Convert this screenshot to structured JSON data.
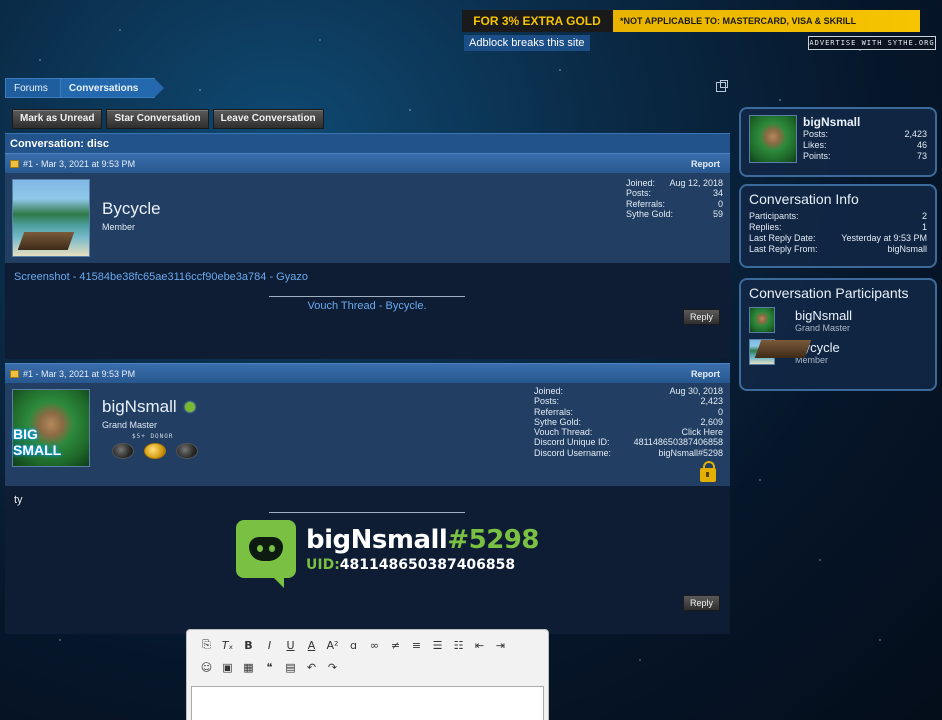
{
  "banner": {
    "left_text": "FOR 3% EXTRA GOLD",
    "right_text": "*NOT APPLICABLE TO: MASTERCARD, VISA & SKRILL",
    "adblock": "Adblock breaks this site",
    "advertise": "ADVERTISE WITH SYTHE.ORG"
  },
  "breadcrumb": {
    "forums": "Forums",
    "conversations": "Conversations"
  },
  "actions": {
    "mark_unread": "Mark as Unread",
    "star": "Star Conversation",
    "leave": "Leave Conversation"
  },
  "conversation": {
    "title": "Conversation: disc"
  },
  "posts": [
    {
      "meta": "#1 - Mar 3, 2021 at 9:53 PM",
      "report": "Report",
      "username": "Bycycle",
      "title": "Member",
      "stats": [
        {
          "label": "Joined:",
          "value": "Aug 12, 2018"
        },
        {
          "label": "Posts:",
          "value": "34"
        },
        {
          "label": "Referrals:",
          "value": "0"
        },
        {
          "label": "Sythe Gold:",
          "value": "59"
        }
      ],
      "link": "Screenshot - 41584be38fc65ae3116ccf90ebe3a784 - Gyazo",
      "signature": "Vouch Thread - Bycycle.",
      "reply": "Reply"
    },
    {
      "meta": "#1 - Mar 3, 2021 at 9:53 PM",
      "report": "Report",
      "username": "bigNsmall",
      "title": "Grand Master",
      "donor": "$5+ DONOR",
      "avatar_text": "BIG SMALL",
      "stats": [
        {
          "label": "Joined:",
          "value": "Aug 30, 2018"
        },
        {
          "label": "Posts:",
          "value": "2,423"
        },
        {
          "label": "Referrals:",
          "value": "0"
        },
        {
          "label": "Sythe Gold:",
          "value": "2,609"
        },
        {
          "label": "Vouch Thread:",
          "value": "Click Here"
        },
        {
          "label": "Discord Unique ID:",
          "value": "481148650387406858"
        },
        {
          "label": "Discord Username:",
          "value": "bigNsmall#5298"
        }
      ],
      "body": "ty",
      "discord_name": "bigNsmall",
      "discord_tag": "#5298",
      "discord_uid_label": "UID:",
      "discord_uid": "481148650387406858",
      "reply": "Reply"
    }
  ],
  "sidebar": {
    "profile": {
      "name": "bigNsmall",
      "stats": [
        {
          "label": "Posts:",
          "value": "2,423"
        },
        {
          "label": "Likes:",
          "value": "46"
        },
        {
          "label": "Points:",
          "value": "73"
        }
      ]
    },
    "info": {
      "title": "Conversation Info",
      "rows": [
        {
          "label": "Participants:",
          "value": "2"
        },
        {
          "label": "Replies:",
          "value": "1"
        },
        {
          "label": "Last Reply Date:",
          "value": "Yesterday at 9:53 PM"
        },
        {
          "label": "Last Reply From:",
          "value": "bigNsmall"
        }
      ]
    },
    "participants": {
      "title": "Conversation Participants",
      "list": [
        {
          "name": "bigNsmall",
          "title": "Grand Master"
        },
        {
          "name": "Bycycle",
          "title": "Member"
        }
      ]
    }
  },
  "editor": {
    "toolbar_icons": [
      "remove-format-icon",
      "clear-formatting-icon",
      "bold-icon",
      "italic-icon",
      "underline-icon",
      "font-color-icon",
      "font-size-icon",
      "font-family-icon",
      "link-icon",
      "unlink-icon",
      "align-icon",
      "bullet-list-icon",
      "numbered-list-icon",
      "outdent-icon",
      "indent-icon",
      "smilie-icon",
      "image-icon",
      "media-icon",
      "quote-icon",
      "save-draft-icon",
      "undo-icon",
      "redo-icon"
    ]
  }
}
